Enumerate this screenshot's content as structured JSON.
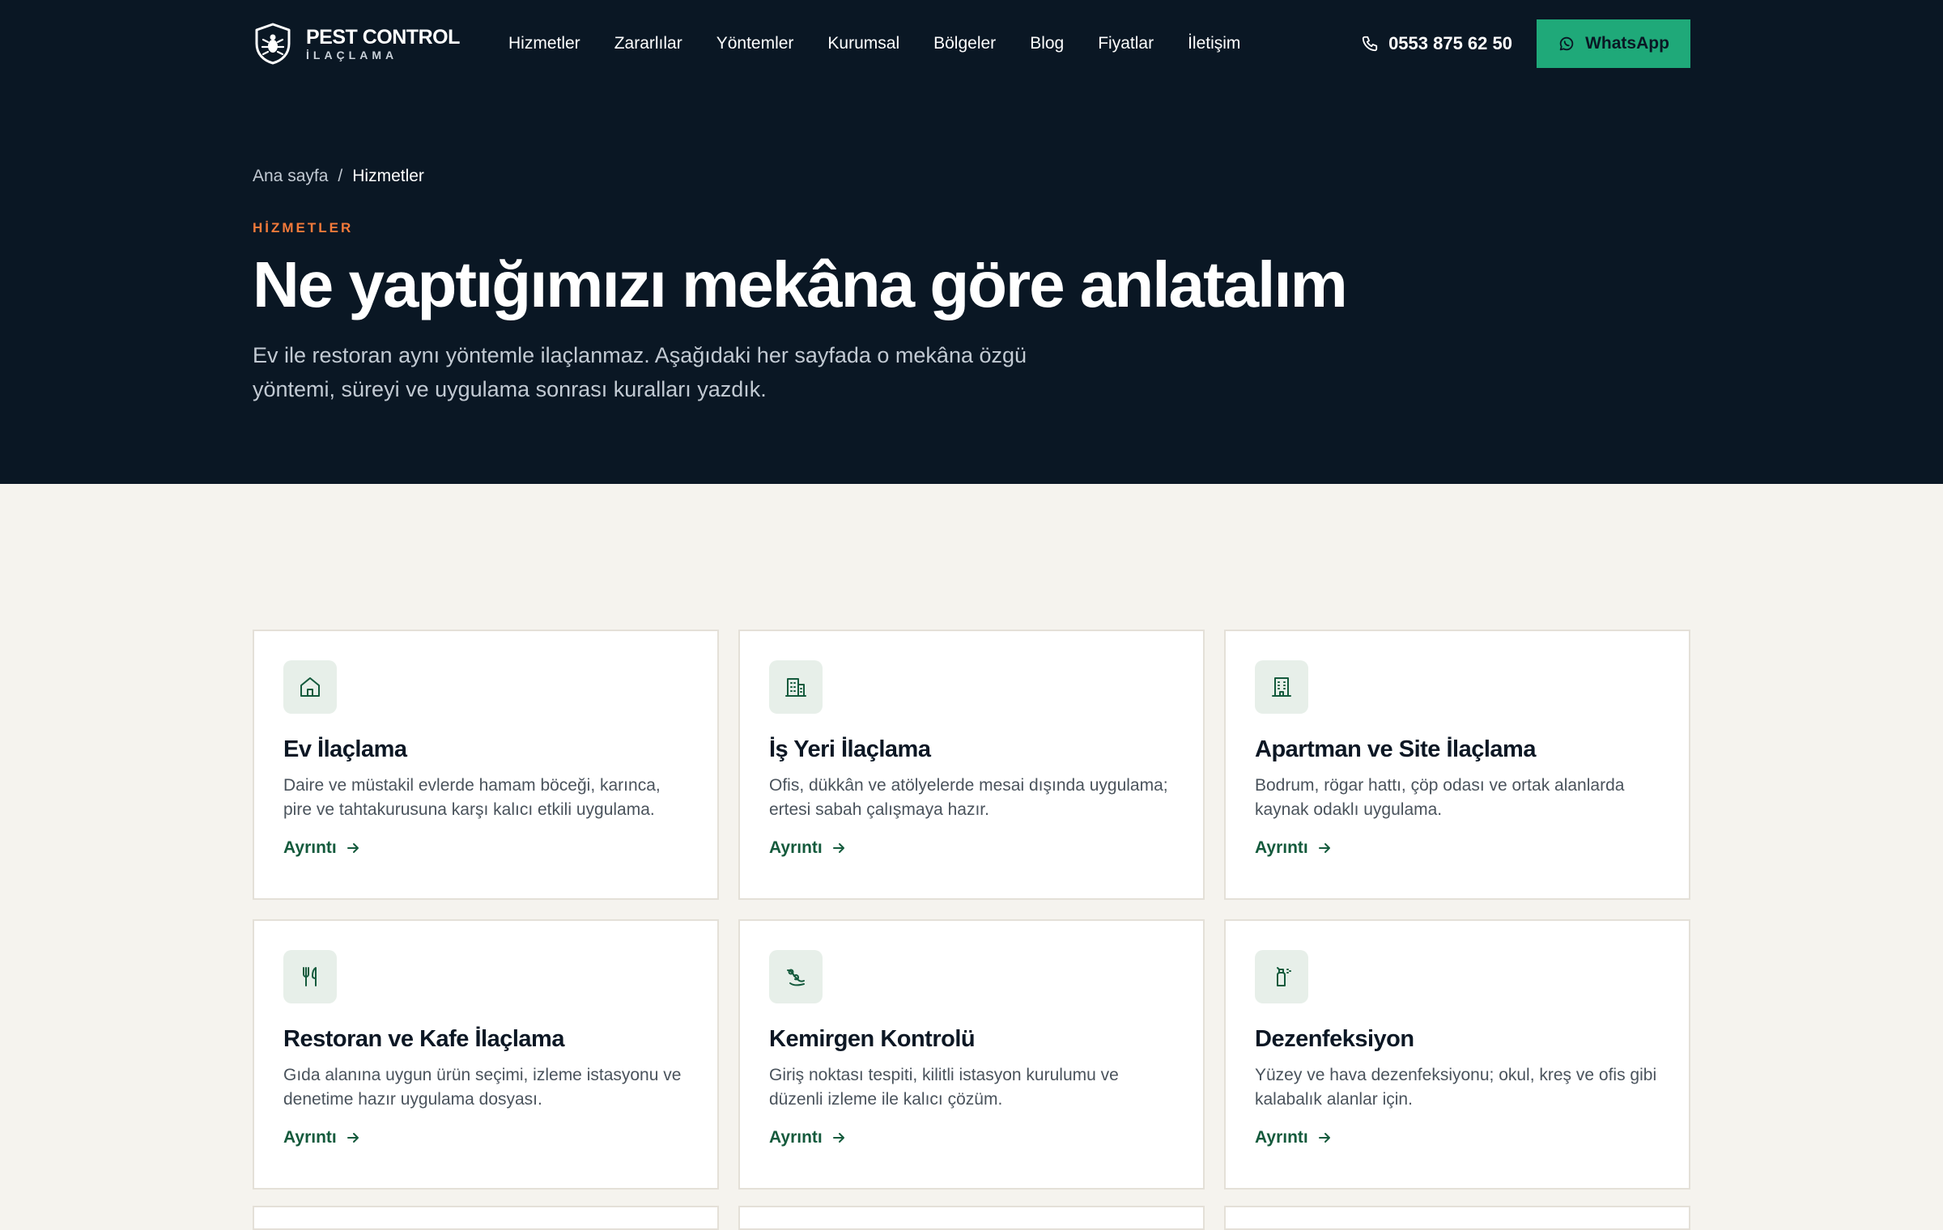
{
  "brand": {
    "title": "PEST CONTROL",
    "subtitle": "İLAÇLAMA",
    "logo_icon": "shield-bug-icon"
  },
  "nav": {
    "items": [
      "Hizmetler",
      "Zararlılar",
      "Yöntemler",
      "Kurumsal",
      "Bölgeler",
      "Blog",
      "Fiyatlar",
      "İletişim"
    ],
    "phone": "0553 875 62 50",
    "whatsapp_label": "WhatsApp"
  },
  "breadcrumb": {
    "home": "Ana sayfa",
    "separator": "/",
    "current": "Hizmetler"
  },
  "hero": {
    "eyebrow": "HİZMETLER",
    "title": "Ne yaptığımızı mekâna göre anlatalım",
    "description": "Ev ile restoran aynı yöntemle ilaçlanmaz. Aşağıdaki her sayfada o mekâna özgü yöntemi, süreyi ve uygulama sonrası kuralları yazdık."
  },
  "cards": [
    {
      "icon": "home-icon",
      "title": "Ev İlaçlama",
      "description": "Daire ve müstakil evlerde hamam böceği, karınca, pire ve tahtakurusuna karşı kalıcı etkili uygulama.",
      "link": "Ayrıntı"
    },
    {
      "icon": "office-building-icon",
      "title": "İş Yeri İlaçlama",
      "description": "Ofis, dükkân ve atölyelerde mesai dışında uygulama; ertesi sabah çalışmaya hazır.",
      "link": "Ayrıntı"
    },
    {
      "icon": "apartment-building-icon",
      "title": "Apartman ve Site İlaçlama",
      "description": "Bodrum, rögar hattı, çöp odası ve ortak alanlarda kaynak odaklı uygulama.",
      "link": "Ayrıntı"
    },
    {
      "icon": "utensils-icon",
      "title": "Restoran ve Kafe İlaçlama",
      "description": "Gıda alanına uygun ürün seçimi, izleme istasyonu ve denetime hazır uygulama dosyası.",
      "link": "Ayrıntı"
    },
    {
      "icon": "rodent-icon",
      "title": "Kemirgen Kontrolü",
      "description": "Giriş noktası tespiti, kilitli istasyon kurulumu ve düzenli izleme ile kalıcı çözüm.",
      "link": "Ayrıntı"
    },
    {
      "icon": "spray-bottle-icon",
      "title": "Dezenfeksiyon",
      "description": "Yüzey ve hava dezenfeksiyonu; okul, kreş ve ofis gibi kalabalık alanlar için.",
      "link": "Ayrıntı"
    }
  ],
  "colors": {
    "hero_bg": "#0a1724",
    "page_bg": "#f5f3ee",
    "accent_green": "#1fa979",
    "dark_green": "#145a3c",
    "eyebrow_orange": "#f47a3a"
  }
}
